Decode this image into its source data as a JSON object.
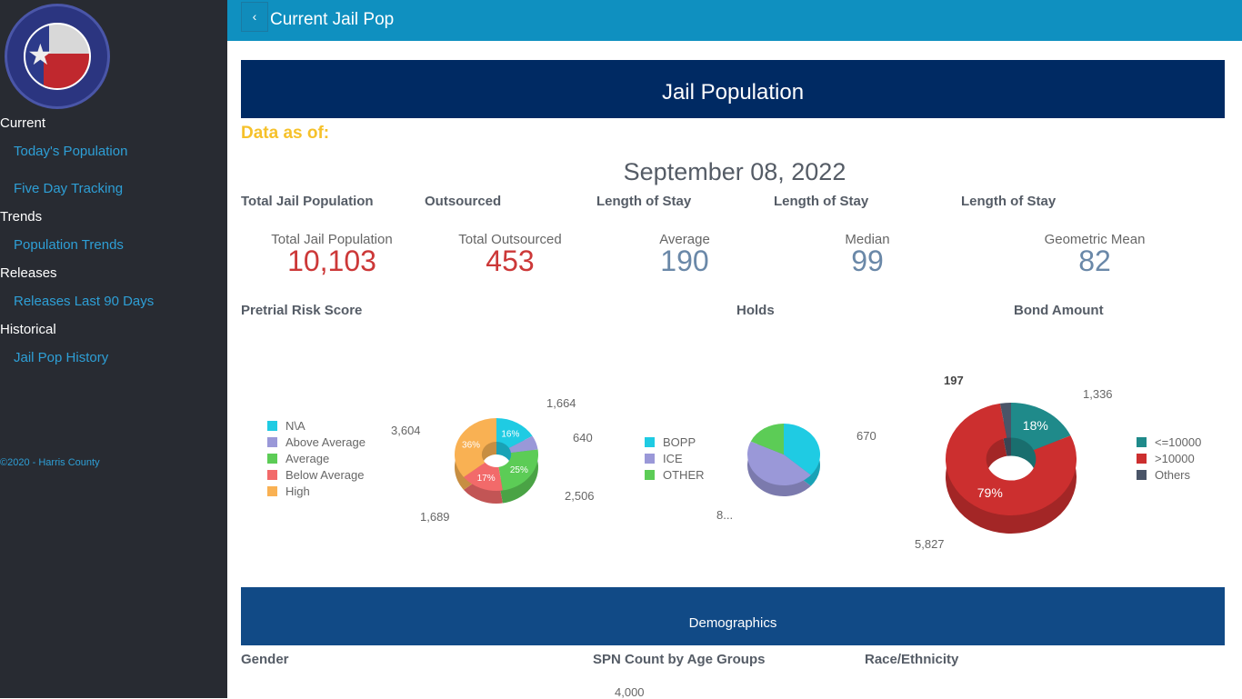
{
  "logo": {
    "text_top": "HARRIS COUNTY",
    "text_bottom": "TEXAS"
  },
  "sidebar": {
    "sections": [
      {
        "title": "Current",
        "items": [
          "Today's Population",
          "Five Day Tracking"
        ]
      },
      {
        "title": "Trends",
        "items": [
          "Population Trends"
        ]
      },
      {
        "title": "Releases",
        "items": [
          "Releases Last 90 Days"
        ]
      },
      {
        "title": "Historical",
        "items": [
          "Jail Pop History"
        ]
      }
    ],
    "copyright": "©2020 - Harris County"
  },
  "topbar": {
    "back_icon": "chevron-left-icon",
    "title": "Current Jail Pop"
  },
  "main": {
    "banner": "Jail Population",
    "data_as_of": "Data as of:",
    "date": "September 08, 2022",
    "kpis": [
      {
        "heading": "Total Jail Population",
        "label": "Total Jail Population",
        "value": "10,103"
      },
      {
        "heading": "Outsourced",
        "label": "Total Outsourced",
        "value": "453"
      },
      {
        "heading": "Length of Stay",
        "label": "Average",
        "value": "190"
      },
      {
        "heading": "Length of Stay",
        "label": "Median",
        "value": "99"
      },
      {
        "heading": "Length of Stay",
        "label": "Geometric Mean",
        "value": "82"
      }
    ],
    "demographics_banner": "Demographics",
    "demo_headings": [
      "Gender",
      "SPN Count by Age Groups",
      "Race/Ethnicity"
    ],
    "age_axis_tick": "4,000"
  },
  "chart_data": [
    {
      "type": "pie",
      "title": "Pretrial Risk Score",
      "legend_position": "left",
      "categories": [
        "N\\A",
        "Above Average",
        "Average",
        "Below Average",
        "High"
      ],
      "values": [
        1664,
        640,
        2506,
        1689,
        3604
      ],
      "value_labels": [
        "1,664",
        "640",
        "2,506",
        "1,689",
        "3,604"
      ],
      "percent_labels": [
        "16%",
        "",
        "25%",
        "17%",
        "36%"
      ],
      "colors": [
        "#1fcbe3",
        "#9a98d8",
        "#5ccc56",
        "#f26a6a",
        "#f9b153"
      ]
    },
    {
      "type": "pie",
      "title": "Holds",
      "legend_position": "left",
      "categories": [
        "BOPP",
        "ICE",
        "OTHER"
      ],
      "values": [
        670,
        830,
        330
      ],
      "value_labels": [
        "670",
        "8...",
        ""
      ],
      "colors": [
        "#1fcbe3",
        "#9a98d8",
        "#5ccc56"
      ]
    },
    {
      "type": "pie",
      "title": "Bond Amount",
      "legend_position": "right",
      "categories": [
        "<=10000",
        ">10000",
        "Others"
      ],
      "values": [
        1336,
        5827,
        197
      ],
      "value_labels": [
        "1,336",
        "5,827",
        "197"
      ],
      "percent_labels": [
        "18%",
        "79%",
        ""
      ],
      "colors": [
        "#1f8a8a",
        "#cc2f2f",
        "#4a5568"
      ]
    }
  ]
}
